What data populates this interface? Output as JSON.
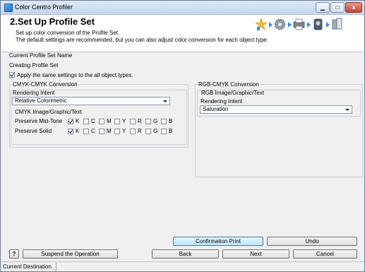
{
  "window": {
    "title": "Color Centro Profiler"
  },
  "header": {
    "title": "2.Set Up Profile Set",
    "desc_line1": "Set up color conversion of the Profile Set.",
    "desc_line2": "The default settings are recommended, but you can also adjust color conversion for each object type."
  },
  "profile": {
    "name_label": "Current Profile Set Name",
    "name_value": "Creating Profile Set"
  },
  "apply_all": {
    "label": "Apply the same settings to the all object types.",
    "checked": true
  },
  "cmyk": {
    "group_title": "CMYK-CMYK Conversion",
    "intent_label": "Rendering Intent",
    "intent_value": "Relative Colorimetric",
    "object_title": "CMYK Image/Graphic/Text",
    "rows": [
      {
        "label": "Preserve Mid-Tone"
      },
      {
        "label": "Preserve Solid"
      }
    ],
    "channels": [
      "K",
      "C",
      "M",
      "Y",
      "R",
      "G",
      "B"
    ],
    "checked_channel": "K"
  },
  "rgb": {
    "group_title": "RGB-CMYK Conversion",
    "object_title": "RGB Image/Graphic/Text",
    "intent_label": "Rendering Intent",
    "intent_value": "Saturation"
  },
  "buttons": {
    "confirmation": "Confirmation Print",
    "undo": "Undo",
    "help": "?",
    "suspend": "Suspend the Operation",
    "back": "Back",
    "next": "Next",
    "cancel": "Cancel"
  },
  "status": {
    "current_destination": "Current Destination"
  }
}
